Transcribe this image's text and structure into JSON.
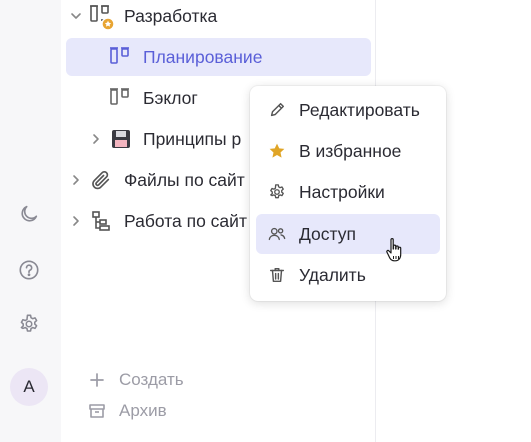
{
  "sidebar": {
    "tree": [
      {
        "label": "Разработка",
        "expanded": true,
        "icon": "kanban-board-icon"
      },
      {
        "label": "Планирование",
        "selected": true,
        "icon": "kanban-board-icon"
      },
      {
        "label": "Бэклог",
        "icon": "kanban-board-icon"
      },
      {
        "label": "Принципы р",
        "expanded": false,
        "icon": "floppy-disk-icon"
      },
      {
        "label": "Файлы по сайт",
        "expanded": false,
        "icon": "paperclip-icon"
      },
      {
        "label": "Работа по сайт",
        "expanded": false,
        "icon": "hierarchy-icon"
      }
    ],
    "create_label": "Создать",
    "archive_label": "Архив"
  },
  "rail": {
    "avatar_initial": "A",
    "icons": [
      "moon-icon",
      "help-icon",
      "gear-icon"
    ]
  },
  "context_menu": {
    "items": [
      {
        "label": "Редактировать",
        "icon": "pencil-icon"
      },
      {
        "label": "В избранное",
        "icon": "star-icon"
      },
      {
        "label": "Настройки",
        "icon": "gear-icon"
      },
      {
        "label": "Доступ",
        "icon": "users-icon",
        "hovered": true
      },
      {
        "label": "Удалить",
        "icon": "trash-icon"
      }
    ]
  },
  "colors": {
    "accent": "#5a5fd8",
    "selected_bg": "#e7e8fb",
    "favorite_star": "#e0a526",
    "badge": "#e8a533"
  }
}
